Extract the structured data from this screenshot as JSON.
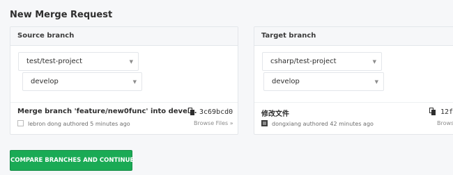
{
  "page": {
    "title": "New Merge Request"
  },
  "source": {
    "header": "Source branch",
    "project": "test/test-project",
    "branch": "develop",
    "commit": {
      "title": "Merge branch 'feature/new0func' into devel…",
      "meta": "lebron dong authored 5 minutes ago",
      "sha": "3c69bcd0",
      "browse": "Browse Files »"
    }
  },
  "target": {
    "header": "Target branch",
    "project": "csharp/test-project",
    "branch": "develop",
    "commit": {
      "title": "修改文件",
      "meta": "dongxiang authored 42 minutes ago",
      "sha": "12f",
      "browse": "Brows"
    }
  },
  "actions": {
    "compare_label": "COMPARE BRANCHES AND CONTINUE"
  },
  "colors": {
    "accent": "#1aaa55",
    "panel_header": "#f6f7f9",
    "border": "#e3e6ea"
  },
  "icons": {
    "select_caret": "caret-down-icon",
    "copy": "clipboard-icon"
  }
}
